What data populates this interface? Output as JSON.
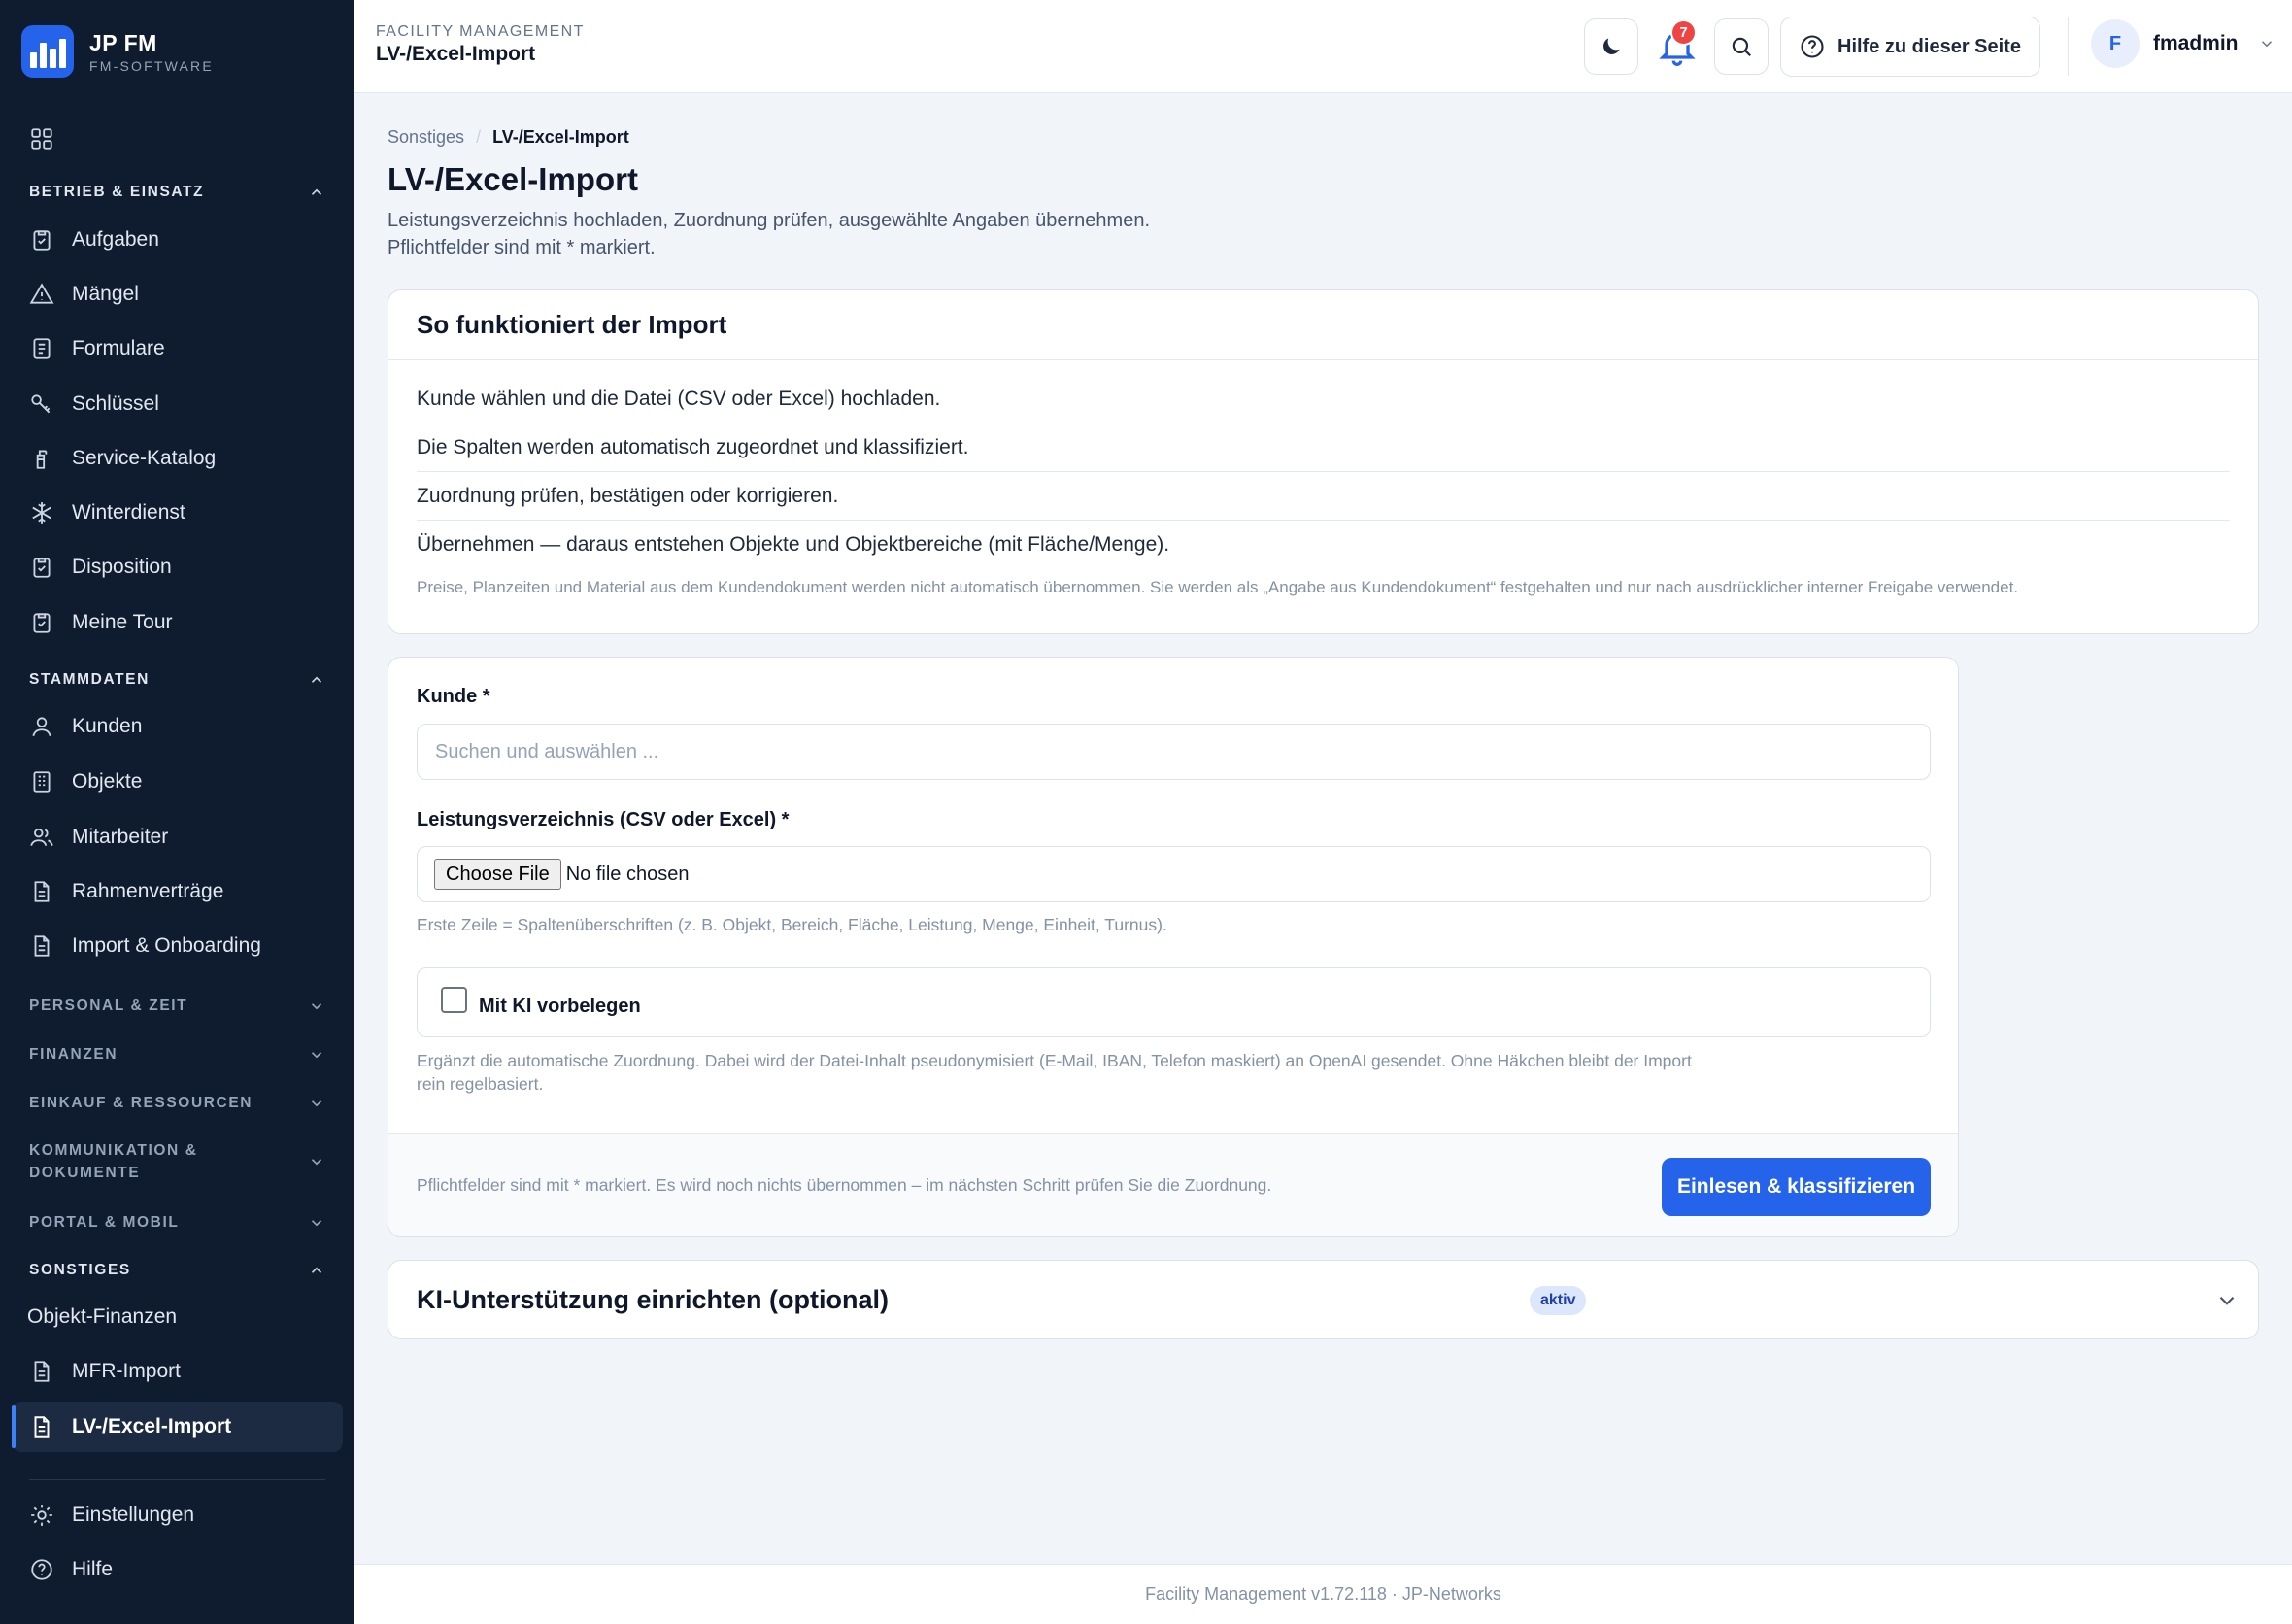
{
  "brand": {
    "name": "JP FM",
    "subtitle": "FM-SOFTWARE"
  },
  "sidebar": {
    "dashboard": "Dashboard",
    "sections": {
      "betrieb": "BETRIEB & EINSATZ",
      "stammdaten": "STAMMDATEN",
      "personal": "PERSONAL & ZEIT",
      "finanzen": "FINANZEN",
      "einkauf": "EINKAUF & RESSOURCEN",
      "kommunikation_1": "KOMMUNIKATION &",
      "kommunikation_2": "DOKUMENTE",
      "portal": "PORTAL & MOBIL",
      "sonstiges": "SONSTIGES"
    },
    "items": {
      "aufgaben": "Aufgaben",
      "maengel": "Mängel",
      "formulare": "Formulare",
      "schluessel": "Schlüssel",
      "service_katalog": "Service-Katalog",
      "winterdienst": "Winterdienst",
      "disposition": "Disposition",
      "meine_tour": "Meine Tour",
      "kunden": "Kunden",
      "objekte": "Objekte",
      "mitarbeiter": "Mitarbeiter",
      "rahmenvertraege": "Rahmenverträge",
      "import_onboarding": "Import & Onboarding",
      "objekt_finanzen": "Objekt-Finanzen",
      "mfr_import": "MFR-Import",
      "lv_import": "LV-/Excel-Import",
      "einstellungen": "Einstellungen",
      "hilfe": "Hilfe"
    }
  },
  "topbar": {
    "context": "FACILITY MANAGEMENT",
    "title": "LV-/Excel-Import",
    "notification_count": "7",
    "help_label": "Hilfe zu dieser Seite",
    "user_initial": "F",
    "user_name": "fmadmin"
  },
  "breadcrumb": {
    "parent": "Sonstiges",
    "sep": "/",
    "current": "LV-/Excel-Import"
  },
  "page": {
    "title": "LV-/Excel-Import",
    "desc_1": "Leistungsverzeichnis hochladen, Zuordnung prüfen, ausgewählte Angaben übernehmen.",
    "desc_2": "Pflichtfelder sind mit * markiert."
  },
  "how": {
    "title": "So funktioniert der Import",
    "steps": [
      "Kunde wählen und die Datei (CSV oder Excel) hochladen.",
      "Die Spalten werden automatisch zugeordnet und klassifiziert.",
      "Zuordnung prüfen, bestätigen oder korrigieren.",
      "Übernehmen — daraus entstehen Objekte und Objektbereiche (mit Fläche/Menge)."
    ],
    "note": "Preise, Planzeiten und Material aus dem Kundendokument werden nicht automatisch übernommen. Sie werden als „Angabe aus Kundendokument“ festgehalten und nur nach ausdrücklicher interner Freigabe verwendet."
  },
  "form": {
    "kunde_label": "Kunde *",
    "kunde_placeholder": "Suchen und auswählen ...",
    "lv_label": "Leistungsverzeichnis (CSV oder Excel) *",
    "file_button": "Choose File",
    "file_status": "No file chosen",
    "file_hint": "Erste Zeile = Spaltenüberschriften (z. B. Objekt, Bereich, Fläche, Leistung, Menge, Einheit, Turnus).",
    "ki_label": "Mit KI vorbelegen",
    "ki_hint_1": "Ergänzt die automatische Zuordnung. Dabei wird der Datei-Inhalt pseudonymisiert (E-Mail, IBAN, Telefon maskiert) an OpenAI gesendet. Ohne Häkchen bleibt der Import",
    "ki_hint_2": "rein regelbasiert.",
    "footer_note": "Pflichtfelder sind mit * markiert. Es wird noch nichts übernommen – im nächsten Schritt prüfen Sie die Zuordnung.",
    "submit": "Einlesen & klassifizieren"
  },
  "ki_setup": {
    "title": "KI-Unterstützung einrichten (optional)",
    "badge": "aktiv"
  },
  "footer": {
    "text": "Facility Management v1.72.118 · JP-Networks"
  },
  "colors": {
    "sidebar_bg": "#0f1b2e",
    "accent": "#2563eb",
    "badge_red": "#ef4444"
  }
}
